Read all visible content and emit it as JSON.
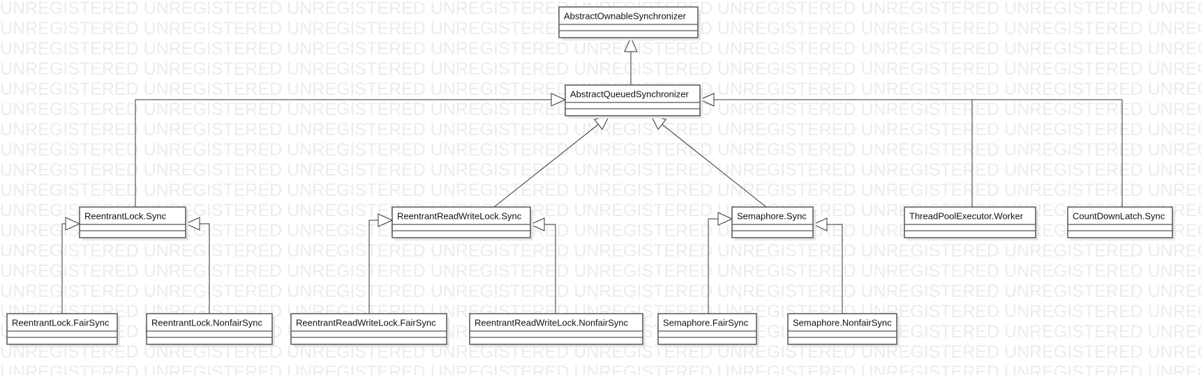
{
  "watermark": "UNREGISTERED",
  "classes": [
    {
      "id": "aos",
      "name": "AbstractOwnableSynchronizer"
    },
    {
      "id": "aqs",
      "name": "AbstractQueuedSynchronizer"
    },
    {
      "id": "rls",
      "name": "ReentrantLock.Sync"
    },
    {
      "id": "rrwls",
      "name": "ReentrantReadWriteLock.Sync"
    },
    {
      "id": "sems",
      "name": "Semaphore.Sync"
    },
    {
      "id": "tpew",
      "name": "ThreadPoolExecutor.Worker"
    },
    {
      "id": "cdls",
      "name": "CountDownLatch.Sync"
    },
    {
      "id": "rlf",
      "name": "ReentrantLock.FairSync"
    },
    {
      "id": "rlnf",
      "name": "ReentrantLock.NonfairSync"
    },
    {
      "id": "rrwlf",
      "name": "ReentrantReadWriteLock.FairSync"
    },
    {
      "id": "rrwlnf",
      "name": "ReentrantReadWriteLock.NonfairSync"
    },
    {
      "id": "semf",
      "name": "Semaphore.FairSync"
    },
    {
      "id": "semnf",
      "name": "Semaphore.NonfairSync"
    }
  ],
  "generalizations": [
    {
      "from": "aqs",
      "to": "aos"
    },
    {
      "from": "rls",
      "to": "aqs"
    },
    {
      "from": "rrwls",
      "to": "aqs"
    },
    {
      "from": "sems",
      "to": "aqs"
    },
    {
      "from": "tpew",
      "to": "aqs"
    },
    {
      "from": "cdls",
      "to": "aqs"
    },
    {
      "from": "rlf",
      "to": "rls"
    },
    {
      "from": "rlnf",
      "to": "rls"
    },
    {
      "from": "rrwlf",
      "to": "rrwls"
    },
    {
      "from": "rrwlnf",
      "to": "rrwls"
    },
    {
      "from": "semf",
      "to": "sems"
    },
    {
      "from": "semnf",
      "to": "sems"
    }
  ]
}
